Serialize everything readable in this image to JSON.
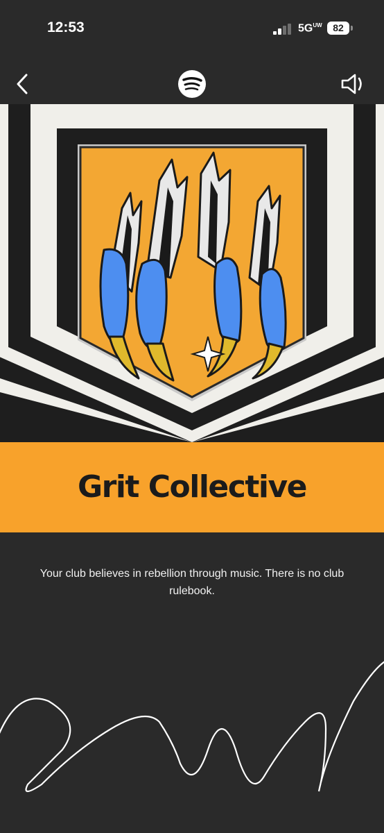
{
  "status_bar": {
    "time": "12:53",
    "network": "5G",
    "network_sup": "UW",
    "battery": "82"
  },
  "nav": {
    "back_icon": "chevron-left-icon",
    "logo_icon": "spotify-logo-icon",
    "sound_icon": "speaker-icon"
  },
  "club": {
    "name": "Grit Collective",
    "description": "Your club believes in rebellion through music. There is no club rulebook."
  },
  "colors": {
    "background": "#2a2a2a",
    "banner": "#f8a22b",
    "badge_fill": "#f3a733",
    "claw_blue": "#4d8ef0",
    "talon_yellow": "#e0b92c",
    "stripe_light": "#f0efea"
  }
}
